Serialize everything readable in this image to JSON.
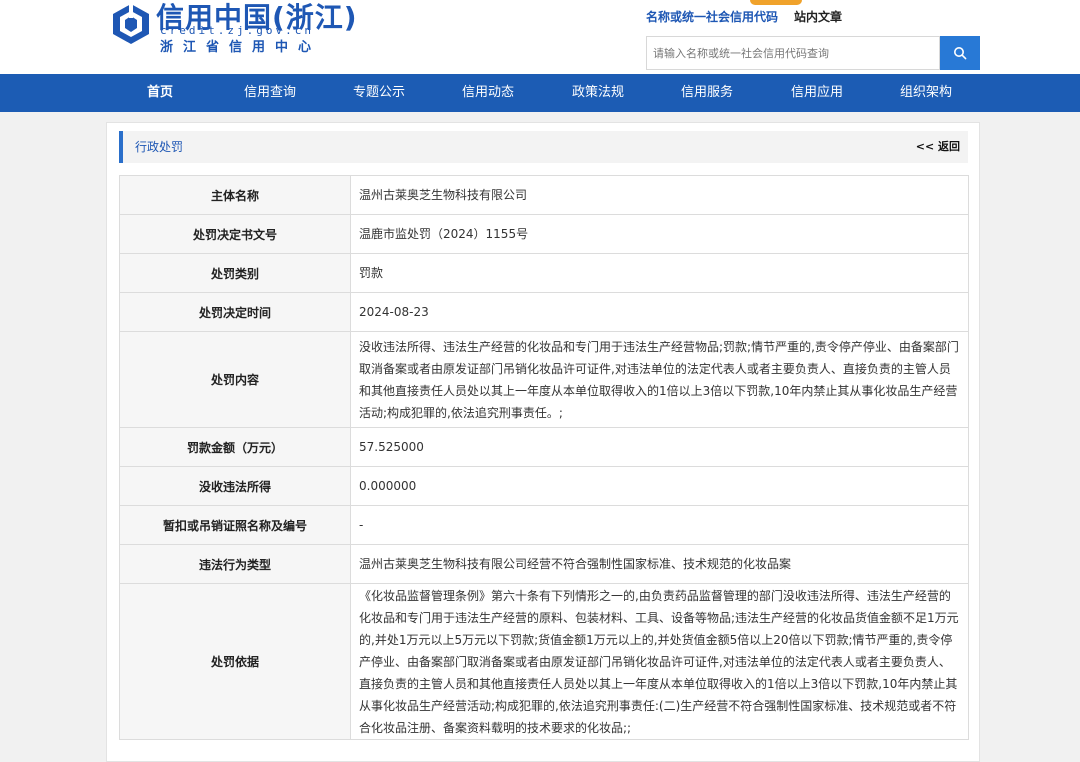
{
  "header": {
    "logo_title": "信用中国(浙江)",
    "logo_url": "credit.zj.gov.cn",
    "logo_subtitle": "浙江省信用中心",
    "search_types": [
      "名称或统一社会信用代码",
      "站内文章"
    ],
    "search_placeholder": "请输入名称或统一社会信用代码查询",
    "search_icon": "search-icon",
    "colors": {
      "brand": "#1c5cb4",
      "accent": "#f0a22b",
      "button": "#2879d6"
    }
  },
  "nav": {
    "items": [
      "首页",
      "信用查询",
      "专题公示",
      "信用动态",
      "政策法规",
      "信用服务",
      "信用应用",
      "组织架构"
    ]
  },
  "section": {
    "title": "行政处罚",
    "back_label": "<< 返回"
  },
  "record": {
    "rows": [
      {
        "label": "主体名称",
        "value": "温州古莱奥芝生物科技有限公司"
      },
      {
        "label": "处罚决定书文号",
        "value": "温鹿市监处罚（2024）1155号"
      },
      {
        "label": "处罚类别",
        "value": "罚款"
      },
      {
        "label": "处罚决定时间",
        "value": "2024-08-23"
      },
      {
        "label": "处罚内容",
        "value": "没收违法所得、违法生产经营的化妆品和专门用于违法生产经营物品;罚款;情节严重的,责令停产停业、由备案部门取消备案或者由原发证部门吊销化妆品许可证件,对违法单位的法定代表人或者主要负责人、直接负责的主管人员和其他直接责任人员处以其上一年度从本单位取得收入的1倍以上3倍以下罚款,10年内禁止其从事化妆品生产经营活动;构成犯罪的,依法追究刑事责任。;"
      },
      {
        "label": "罚款金额（万元）",
        "value": "57.525000"
      },
      {
        "label": "没收违法所得",
        "value": "0.000000"
      },
      {
        "label": "暂扣或吊销证照名称及编号",
        "value": "-"
      },
      {
        "label": "违法行为类型",
        "value": "温州古莱奥芝生物科技有限公司经营不符合强制性国家标准、技术规范的化妆品案"
      },
      {
        "label": "处罚依据",
        "value": "《化妆品监督管理条例》第六十条有下列情形之一的,由负责药品监督管理的部门没收违法所得、违法生产经营的化妆品和专门用于违法生产经营的原料、包装材料、工具、设备等物品;违法生产经营的化妆品货值金额不足1万元的,并处1万元以上5万元以下罚款;货值金额1万元以上的,并处货值金额5倍以上20倍以下罚款;情节严重的,责令停产停业、由备案部门取消备案或者由原发证部门吊销化妆品许可证件,对违法单位的法定代表人或者主要负责人、直接负责的主管人员和其他直接责任人员处以其上一年度从本单位取得收入的1倍以上3倍以下罚款,10年内禁止其从事化妆品生产经营活动;构成犯罪的,依法追究刑事责任:(二)生产经营不符合强制性国家标准、技术规范或者不符合化妆品注册、备案资料载明的技术要求的化妆品;;"
      }
    ]
  }
}
